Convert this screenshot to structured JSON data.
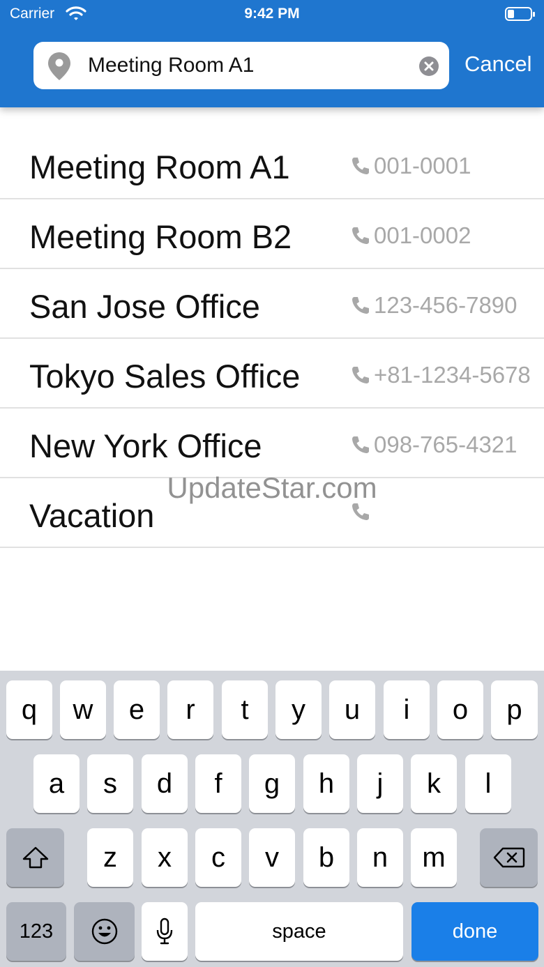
{
  "status_bar": {
    "carrier": "Carrier",
    "time": "9:42 PM"
  },
  "search": {
    "value": "Meeting Room A1",
    "cancel_label": "Cancel"
  },
  "rooms": [
    {
      "name": "Meeting Room A1",
      "phone": "001-0001"
    },
    {
      "name": "Meeting Room B2",
      "phone": "001-0002"
    },
    {
      "name": "San Jose Office",
      "phone": "123-456-7890"
    },
    {
      "name": "Tokyo Sales Office",
      "phone": "+81-1234-5678"
    },
    {
      "name": "New York Office",
      "phone": "098-765-4321"
    },
    {
      "name": "Vacation",
      "phone": ""
    }
  ],
  "watermark": "UpdateStar.com",
  "keyboard": {
    "row1": [
      "q",
      "w",
      "e",
      "r",
      "t",
      "y",
      "u",
      "i",
      "o",
      "p"
    ],
    "row2": [
      "a",
      "s",
      "d",
      "f",
      "g",
      "h",
      "j",
      "k",
      "l"
    ],
    "row3": [
      "z",
      "x",
      "c",
      "v",
      "b",
      "n",
      "m"
    ],
    "numbers_label": "123",
    "space_label": "space",
    "done_label": "done"
  },
  "colors": {
    "header": "#1f76cf",
    "done_key": "#1a7fe8",
    "phone_text": "#a8a8a8"
  },
  "icons": [
    "wifi-icon",
    "battery-icon",
    "location-pin-icon",
    "clear-icon",
    "phone-icon",
    "shift-icon",
    "backspace-icon",
    "emoji-icon",
    "microphone-icon"
  ]
}
